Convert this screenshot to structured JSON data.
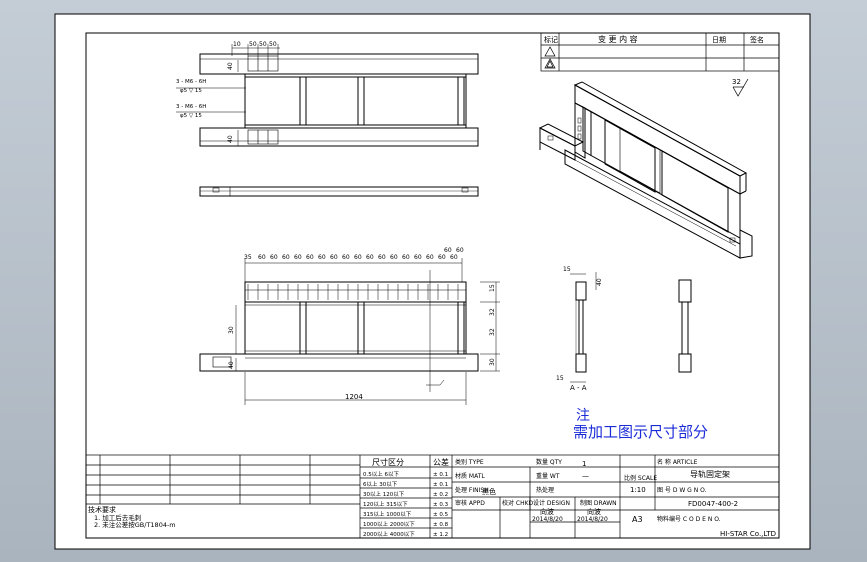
{
  "view": {
    "background": "#b5bec8",
    "paper": "#ffffff",
    "line": "#000000",
    "note_color": "#1a2bd8"
  },
  "note": {
    "title": "注",
    "body": "需加工图示尺寸部分"
  },
  "revision_block": {
    "headers": [
      "标记",
      "变 更 内 容",
      "日期",
      "签名"
    ]
  },
  "surface_finish": "32",
  "dims": {
    "top_widths": [
      "10",
      "50",
      "50",
      "50"
    ],
    "top_left_notes": [
      "3 - M6 - 6H",
      "φ5 ▽ 15",
      "3 - M6 - 6H",
      "φ5 ▽ 15"
    ],
    "top_left_vert": [
      "40",
      "40"
    ],
    "front_top_row": [
      "35",
      "60",
      "60",
      "60",
      "60",
      "60",
      "60",
      "60",
      "60",
      "60",
      "60",
      "60",
      "60",
      "60",
      "60",
      "60",
      "60",
      "60",
      "60",
      "60"
    ],
    "front_left": [
      "30",
      "40"
    ],
    "front_right": [
      "15",
      "32",
      "32",
      "30"
    ],
    "front_width": "1204",
    "section_top": "15",
    "section_top_r": "40",
    "section_bottom": "15",
    "section_bottom_label": "A - A"
  },
  "notes_block": {
    "title": "技术要求",
    "lines": [
      "1. 加工后去毛刺",
      "2. 未注公差按GB/T1804-m"
    ]
  },
  "title_block": {
    "tol_header": "尺寸区分",
    "tol_header2": "公差",
    "tol_rows": [
      [
        "0.5以上 6以下",
        "± 0.1"
      ],
      [
        "6以上 30以下",
        "± 0.1"
      ],
      [
        "30以上 120以下",
        "± 0.2"
      ],
      [
        "120以上 315以下",
        "± 0.3"
      ],
      [
        "315以上 1000以下",
        "± 0.5"
      ],
      [
        "1000以上 2000以下",
        "± 0.8"
      ],
      [
        "2000以上 4000以下",
        "± 1.2"
      ]
    ],
    "type_label": "类别 TYPE",
    "qty_label": "数量 QTY",
    "qty_value": "1",
    "material_label": "材质 MATL",
    "finish_label": "处理 FINISH",
    "weight_label": "重量 WT",
    "weight_value": "—",
    "treatment_label": "热处理",
    "treatment_value": "黑色",
    "scale_label": "比例 SCALE",
    "scale_value": "1:10",
    "approved_label": "审核 APPD",
    "checked_label": "校对 CHKD",
    "design_label": "设计 DESIGN",
    "drawn_label": "制图 DRAWN",
    "designer_name": "向波",
    "drawer_name": "向波",
    "design_date": "2014/8/20",
    "drawn_date": "2014/8/20",
    "sheet_size": "A3",
    "article_label": "名 称 ARTICLE",
    "article_value": "导轨固定架",
    "dwg_label": "图 号 D W G N O.",
    "dwg_value": "FD0047-400-2",
    "code_label": "物料编号 C O D E N O.",
    "company": "HI-STAR Co.,LTD"
  }
}
